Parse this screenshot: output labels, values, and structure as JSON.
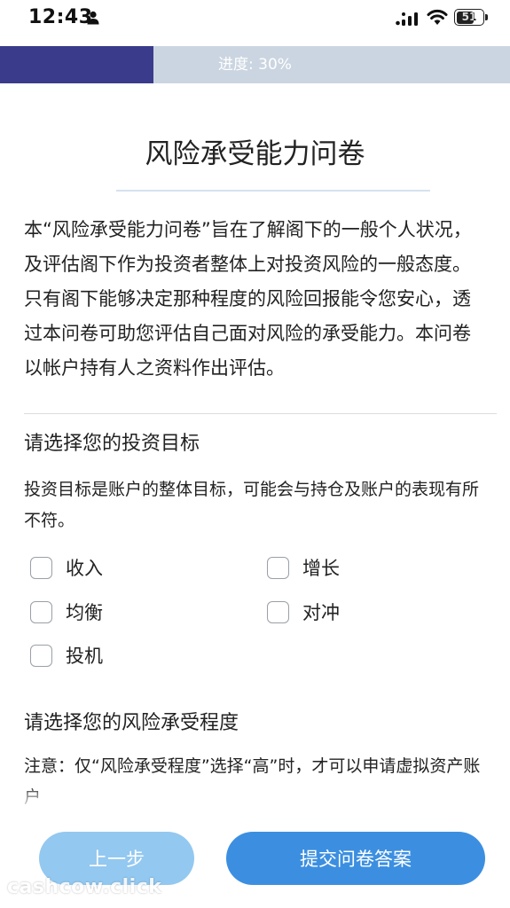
{
  "status_bar": {
    "time": "12:43",
    "battery_level": "51",
    "icons": [
      "person-icon",
      "signal-icon",
      "wifi-icon",
      "battery-icon"
    ]
  },
  "progress": {
    "label": "进度: 30%",
    "fraction": 0.3,
    "fill_color": "#3b3b8c",
    "track_color": "#cbd5e1"
  },
  "page": {
    "title": "风险承受能力问卷",
    "intro": "本“风险承受能力问卷”旨在了解阁下的一般个人状况，及评估阁下作为投资者整体上对投资风险的一般态度。只有阁下能够决定那种程度的风险回报能令您安心，透过本问卷可助您评估自己面对风险的承受能力。本问卷以帐户持有人之资料作出评估。"
  },
  "investment_goal": {
    "heading": "请选择您的投资目标",
    "description": "投资目标是账户的整体目标，可能会与持仓及账户的表现有所不符。",
    "options": [
      {
        "label": "收入",
        "checked": false
      },
      {
        "label": "增长",
        "checked": false
      },
      {
        "label": "均衡",
        "checked": false
      },
      {
        "label": "对冲",
        "checked": false
      },
      {
        "label": "投机",
        "checked": false
      }
    ]
  },
  "risk_level": {
    "heading": "请选择您的风险承受程度",
    "note": "注意：仅“风险承受程度”选择“高”时，才可以申请虚拟资产账户"
  },
  "buttons": {
    "prev": "上一步",
    "submit": "提交问卷答案",
    "prev_color": "#93c8f0",
    "submit_color": "#3c8fe0"
  },
  "watermark": "cashcow.click"
}
